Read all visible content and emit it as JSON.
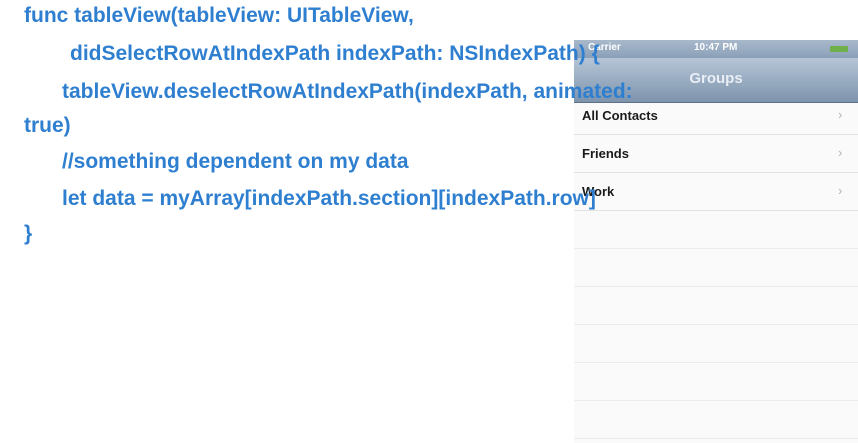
{
  "phone": {
    "status_bar": {
      "carrier": "Carrier",
      "time": "10:47 PM"
    },
    "nav_title": "Groups",
    "rows": [
      {
        "label": "All Contacts"
      },
      {
        "label": "Friends"
      },
      {
        "label": "Work"
      }
    ],
    "chevron_icon": "chevron-right-icon",
    "chevron_glyph": "›"
  },
  "code": {
    "line1": "func tableView(tableView: UITableView,",
    "line2": "didSelectRowAtIndexPath indexPath: NSIndexPath) {",
    "line3": "tableView.deselectRowAtIndexPath(indexPath, animated:",
    "line4": "true)",
    "line5": "//something dependent on my data",
    "line6": "let data = myArray[indexPath.section][indexPath.row]",
    "line7": "}"
  },
  "colors": {
    "code_text": "#2f7fd0",
    "navbar": "#8aa0b8",
    "battery": "#6fb04a"
  }
}
